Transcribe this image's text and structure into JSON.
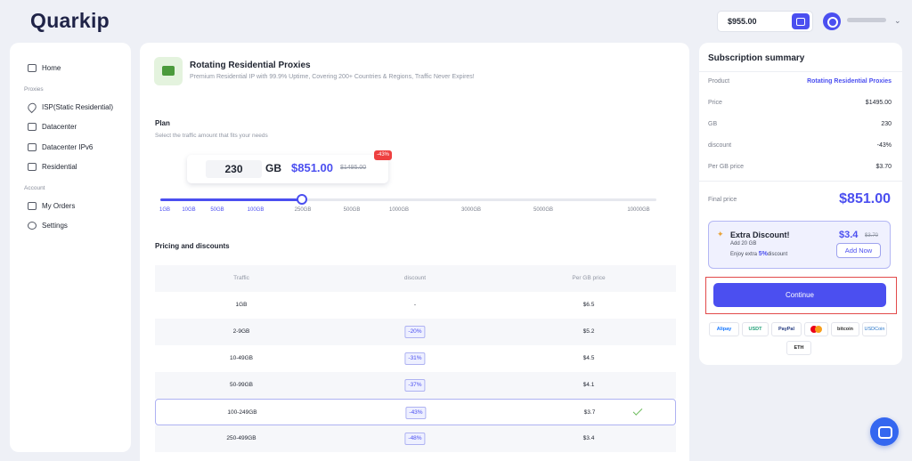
{
  "header": {
    "logo": "Quarkip",
    "balance": "$955.00"
  },
  "sidebar": {
    "home": "Home",
    "section_proxies": "Proxies",
    "isp": "ISP(Static Residential)",
    "datacenter": "Datacenter",
    "datacenter_ipv6": "Datacenter IPv6",
    "residential": "Residential",
    "section_account": "Account",
    "orders": "My Orders",
    "settings": "Settings"
  },
  "product": {
    "title": "Rotating Residential Proxies",
    "subtitle": "Premium Residential IP with 99.9% Uptime, Covering 200+ Countries & Regions, Traffic Never Expires!"
  },
  "plan": {
    "heading": "Plan",
    "subheading": "Select the traffic amount that fits your needs",
    "gb_value": "230",
    "gb_unit": "GB",
    "price": "$851.00",
    "old_price": "$1495.00",
    "badge": "-43%",
    "slider_fraction": 0.285,
    "ticks": [
      "1GB",
      "10GB",
      "50GB",
      "100GB",
      "250GB",
      "500GB",
      "1000GB",
      "3000GB",
      "5000GB",
      "10000GB"
    ],
    "active_ticks": 4
  },
  "pricing": {
    "heading": "Pricing and discounts",
    "columns": [
      "Traffic",
      "discount",
      "Per GB price"
    ],
    "rows": [
      {
        "traffic": "1GB",
        "discount": "-",
        "price": "$6.5"
      },
      {
        "traffic": "2-9GB",
        "discount": "-20%",
        "price": "$5.2"
      },
      {
        "traffic": "10-49GB",
        "discount": "-31%",
        "price": "$4.5"
      },
      {
        "traffic": "50-99GB",
        "discount": "-37%",
        "price": "$4.1"
      },
      {
        "traffic": "100-249GB",
        "discount": "-43%",
        "price": "$3.7",
        "selected": true
      },
      {
        "traffic": "250-499GB",
        "discount": "-48%",
        "price": "$3.4"
      }
    ]
  },
  "summary": {
    "title": "Subscription summary",
    "product_label": "Product",
    "product_value": "Rotating Residential Proxies",
    "price_label": "Price",
    "price_value": "$1495.00",
    "gb_label": "GB",
    "gb_value": "230",
    "discount_label": "discount",
    "discount_value": "-43%",
    "pergb_label": "Per GB price",
    "pergb_value": "$3.70",
    "final_label": "Final price",
    "final_value": "$851.00",
    "extra_title": "Extra Discount!",
    "extra_line1": "Add 20 GB",
    "extra_line2_prefix": "Enjoy extra",
    "extra_line2_pct": "5%",
    "extra_line2_suffix": "discount",
    "extra_price": "$3.4",
    "extra_old": "$3.70",
    "add_now": "Add Now",
    "continue": "Continue"
  },
  "payments": [
    "Alipay",
    "USDT",
    "PayPal",
    "",
    "bitcoin",
    "USDCoin",
    "ETH"
  ],
  "colors": {
    "accent": "#4b4ff0",
    "badge": "#ee4040",
    "highlight_border": "#e24a4a"
  }
}
